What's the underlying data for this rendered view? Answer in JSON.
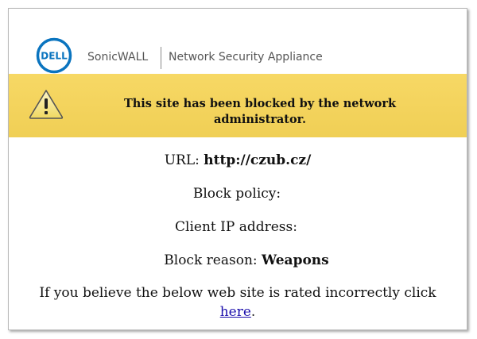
{
  "header": {
    "logo_text": "DELL",
    "brand": "SonicWALL",
    "subtitle": "Network Security Appliance"
  },
  "banner": {
    "icon": "warning-triangle-icon",
    "message": "This site has been blocked by the network administrator."
  },
  "details": {
    "url_label": "URL:",
    "url_value": "http://czub.cz/",
    "policy_label": "Block policy:",
    "policy_value": "",
    "ip_label": "Client IP address:",
    "ip_value": "",
    "reason_label": "Block reason:",
    "reason_value": "Weapons"
  },
  "footer": {
    "note_text": "If you believe the below web site is rated incorrectly click",
    "link_text": "here",
    "end_punct": "."
  },
  "colors": {
    "banner": "#f0cf55",
    "logo_blue": "#0a74bf",
    "link": "#1a0dab"
  }
}
